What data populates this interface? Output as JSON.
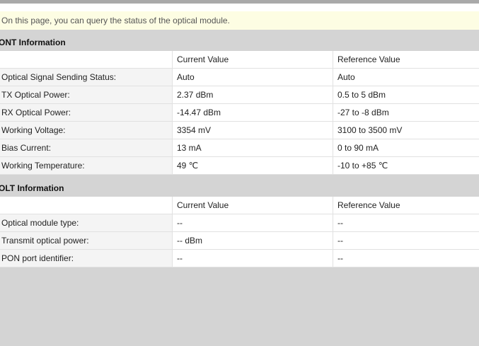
{
  "notice": "On this page, you can query the status of the optical module.",
  "ont": {
    "title": "ONT Information",
    "headers": {
      "current": "Current Value",
      "reference": "Reference Value"
    },
    "rows": [
      {
        "label": "Optical Signal Sending Status:",
        "current": "Auto",
        "reference": "Auto"
      },
      {
        "label": "TX Optical Power:",
        "current": "2.37 dBm",
        "reference": "0.5 to 5 dBm"
      },
      {
        "label": "RX Optical Power:",
        "current": "-14.47 dBm",
        "reference": "-27 to -8 dBm"
      },
      {
        "label": "Working Voltage:",
        "current": "3354 mV",
        "reference": "3100 to 3500 mV"
      },
      {
        "label": "Bias Current:",
        "current": "13 mA",
        "reference": "0 to 90 mA"
      },
      {
        "label": "Working Temperature:",
        "current": "49 ℃",
        "reference": "-10 to +85 ℃"
      }
    ]
  },
  "olt": {
    "title": "OLT Information",
    "headers": {
      "current": "Current Value",
      "reference": "Reference Value"
    },
    "rows": [
      {
        "label": "Optical module type:",
        "current": "--",
        "reference": "--"
      },
      {
        "label": "Transmit optical power:",
        "current": "-- dBm",
        "reference": "--"
      },
      {
        "label": "PON port identifier:",
        "current": "--",
        "reference": "--"
      }
    ]
  }
}
